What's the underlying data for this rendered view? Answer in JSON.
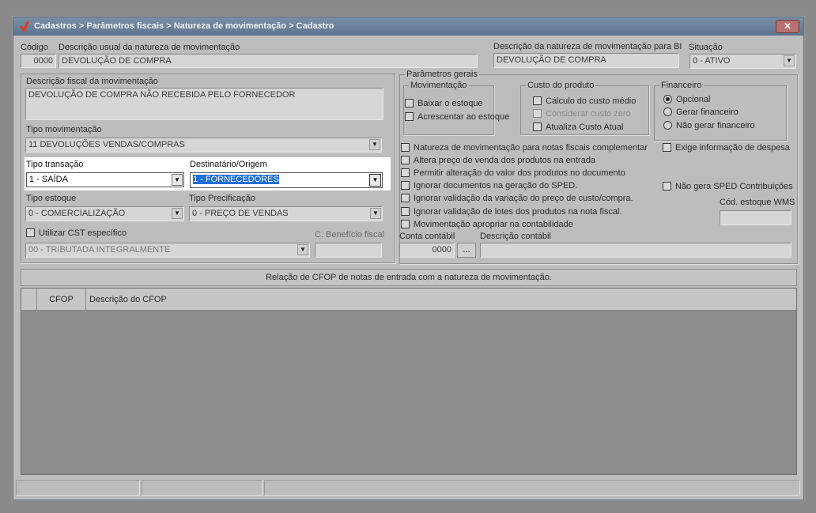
{
  "window": {
    "title": "Cadastros > Parâmetros fiscais > Natureza de movimentação > Cadastro",
    "close_label": "✕"
  },
  "header": {
    "codigo_label": "Código",
    "codigo_value": "0000",
    "descricao_usual_label": "Descrição usual da natureza de movimentação",
    "descricao_usual_value": "DEVOLUÇÃO DE COMPRA",
    "descricao_bi_label": "Descrição da natureza de movimentação para BI",
    "descricao_bi_value": "DEVOLUÇÃO DE COMPRA",
    "situacao_label": "Situação",
    "situacao_value": "0 - ATIVO"
  },
  "left": {
    "descricao_fiscal_label": "Descrição fiscal da movimentação",
    "descricao_fiscal_value": "DEVOLUÇÃO DE COMPRA NÃO RECEBIDA PELO FORNECEDOR",
    "tipo_mov_label": "Tipo movimentação",
    "tipo_mov_value": "11  DEVOLUÇÕES VENDAS/COMPRAS",
    "tipo_transacao_label": "Tipo transação",
    "tipo_transacao_value": "1 - SAÍDA",
    "destinatario_label": "Destinatário/Origem",
    "destinatario_value": "1 - FORNECEDORES",
    "tipo_estoque_label": "Tipo estoque",
    "tipo_estoque_value": "0 - COMERCIALIZAÇÃO",
    "tipo_precificacao_label": "Tipo Precificação",
    "tipo_precificacao_value": "0 - PREÇO DE VENDAS",
    "utilizar_cst_label": "Utilizar CST específico",
    "cst_value": "00 - TRIBUTADA INTEGRALMENTE",
    "beneficio_label": "C. Benefício fiscal"
  },
  "parametros": {
    "title": "Parâmetros gerais",
    "movimentacao_title": "Movimentação",
    "baixar_estoque": "Baixar o estoque",
    "acrescentar_estoque": "Acrescentar ao estoque",
    "custo_title": "Custo do produto",
    "calculo_custo": "Cálculo do custo médio",
    "considerar_custo_zero": "Considerar custo zero",
    "atualiza_custo": "Atualiza Custo Atual",
    "financeiro_title": "Financeiro",
    "opcional": "Opcional",
    "gerar_financeiro": "Gerar financeiro",
    "nao_gerar_financeiro": "Não gerar financeiro",
    "opt_complementar": "Natureza de movimentação para notas fiscais complementar",
    "opt_altera_preco": "Altera preço de venda dos produtos na entrada",
    "opt_permitir_alteracao": "Permitir alteração do valor dos produtos no documento",
    "opt_ignorar_sped": "Ignorar documentos na geração do SPED.",
    "opt_ignorar_variacao": "Ignorar validação da variação do preço de custo/compra.",
    "opt_ignorar_lotes": "Ignorar validação de lotes dos produtos na nota fiscal.",
    "opt_apropriar": "Movimentação apropriar na contabilidade",
    "opt_exige_despesa": "Exige informação de despesa",
    "opt_nao_gera_sped": "Não gera SPED Contribuições",
    "cod_estoque_wms_label": "Cód. estoque WMS",
    "conta_contabil_label": "Conta contábil",
    "conta_contabil_value": "0000",
    "conta_btn": "...",
    "descricao_contabil_label": "Descrição contábil"
  },
  "cfop": {
    "bar_label": "Relação de CFOP de notas de entrada com a natureza de movimentação.",
    "col_cfop": "CFOP",
    "col_descricao": "Descrição do CFOP"
  }
}
